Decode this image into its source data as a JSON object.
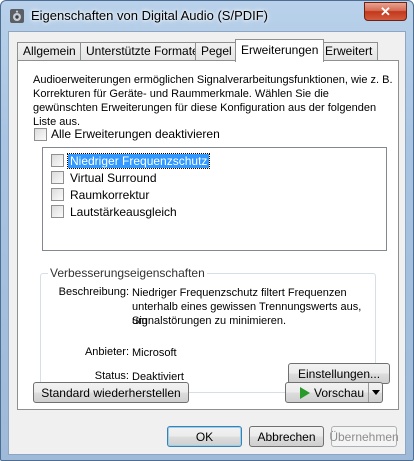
{
  "window": {
    "title": "Eigenschaften von Digital Audio (S/PDIF)",
    "close_label": "✕"
  },
  "tabs": [
    {
      "label": "Allgemein"
    },
    {
      "label": "Unterstützte Formate"
    },
    {
      "label": "Pegel"
    },
    {
      "label": "Erweiterungen",
      "active": true
    },
    {
      "label": "Erweitert"
    }
  ],
  "enhancements": {
    "description": "Audioerweiterungen ermöglichen Signalverarbeitungsfunktionen, wie z. B. Korrekturen für Geräte- und Raummerkmale. Wählen Sie die gewünschten Erweiterungen für diese Konfiguration aus der folgenden Liste aus.",
    "disable_all_label": "Alle Erweiterungen deaktivieren",
    "disable_all_checked": false,
    "items": [
      {
        "label": "Niedriger Frequenzschutz",
        "checked": false,
        "selected": true
      },
      {
        "label": "Virtual Surround",
        "checked": false,
        "selected": false
      },
      {
        "label": "Raumkorrektur",
        "checked": false,
        "selected": false
      },
      {
        "label": "Lautstärkeausgleich",
        "checked": false,
        "selected": false
      }
    ]
  },
  "properties": {
    "group_title": "Verbesserungseigenschaften",
    "description_label": "Beschreibung:",
    "description_line1": "Niedriger Frequenzschutz filtert Frequenzen",
    "description_line2": "unterhalb eines gewissen Trennungswerts aus, um",
    "description_line3": "Signalstörungen zu minimieren.",
    "provider_label": "Anbieter:",
    "provider_value": "Microsoft",
    "status_label": "Status:",
    "status_value": "Deaktiviert",
    "settings_button": "Einstellungen..."
  },
  "actions": {
    "restore_defaults": "Standard wiederherstellen",
    "preview": "Vorschau"
  },
  "dialog_buttons": {
    "ok": "OK",
    "cancel": "Abbrechen",
    "apply": "Übernehmen"
  },
  "icons": {
    "app": "speaker-icon",
    "preview": "play-icon",
    "dropdown": "chevron-down-icon"
  }
}
